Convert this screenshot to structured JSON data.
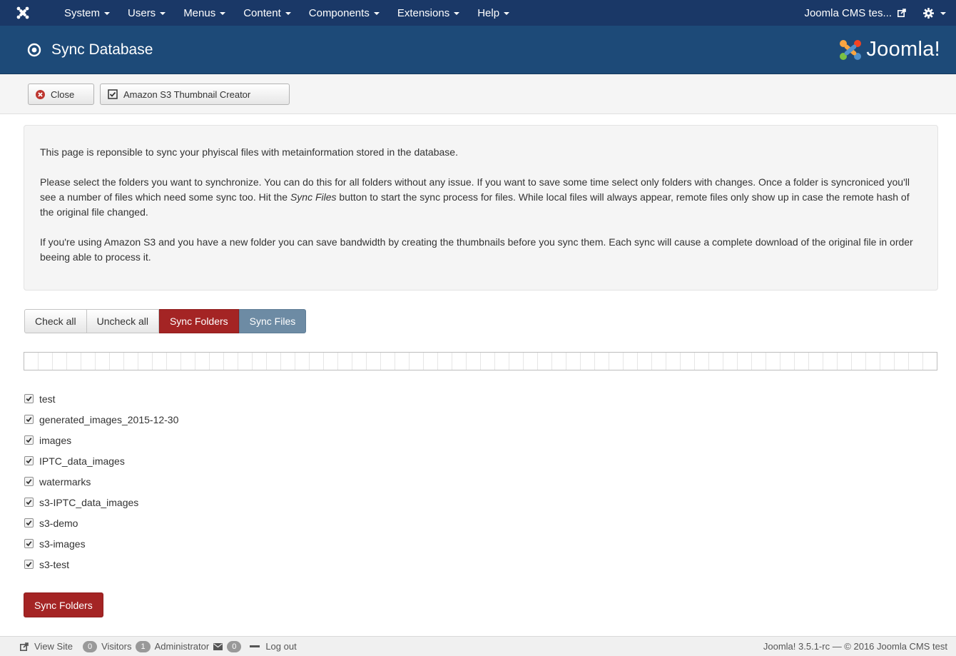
{
  "topnav": {
    "menu": [
      {
        "label": "System"
      },
      {
        "label": "Users"
      },
      {
        "label": "Menus"
      },
      {
        "label": "Content"
      },
      {
        "label": "Components"
      },
      {
        "label": "Extensions"
      },
      {
        "label": "Help"
      }
    ],
    "site_link": "Joomla CMS tes...",
    "icons": {
      "logo": "joomla-icon",
      "external": "external-link-icon",
      "gear": "gear-icon"
    }
  },
  "header": {
    "title": "Sync Database",
    "brand": "Joomla!"
  },
  "toolbar": {
    "close_label": "Close",
    "thumb_label": "Amazon S3 Thumbnail Creator"
  },
  "info": {
    "p1": "This page is reponsible to sync your phyiscal files with metainformation stored in the database.",
    "p2_a": "Please select the folders you want to synchronize. You can do this for all folders without any issue. If you want to save some time select only folders with changes. Once a folder is syncroniced you'll see a number of files which need some sync too. Hit the ",
    "p2_em": "Sync Files",
    "p2_b": " button to start the sync process for files. While local files will always appear, remote files only show up in case the remote hash of the original file changed.",
    "p3": "If you're using Amazon S3 and you have a new folder you can save bandwidth by creating the thumbnails before you sync them. Each sync will cause a complete download of the original file in order beeing able to process it."
  },
  "actions": {
    "check_all": "Check all",
    "uncheck_all": "Uncheck all",
    "sync_folders": "Sync Folders",
    "sync_files": "Sync Files"
  },
  "progress": {
    "value": 0
  },
  "folders": [
    {
      "name": "test",
      "checked": true
    },
    {
      "name": "generated_images_2015-12-30",
      "checked": true
    },
    {
      "name": "images",
      "checked": true
    },
    {
      "name": "IPTC_data_images",
      "checked": true
    },
    {
      "name": "watermarks",
      "checked": true
    },
    {
      "name": "s3-IPTC_data_images",
      "checked": true
    },
    {
      "name": "s3-demo",
      "checked": true
    },
    {
      "name": "s3-images",
      "checked": true
    },
    {
      "name": "s3-test",
      "checked": true
    }
  ],
  "sync_button": "Sync Folders",
  "footer": {
    "view_site": "View Site",
    "visitors_count": "0",
    "visitors": "Visitors",
    "admin_count": "1",
    "administrator": "Administrator",
    "messages_count": "0",
    "logout": "Log out",
    "version": "Joomla! 3.5.1-rc — © 2016 Joomla CMS test"
  }
}
